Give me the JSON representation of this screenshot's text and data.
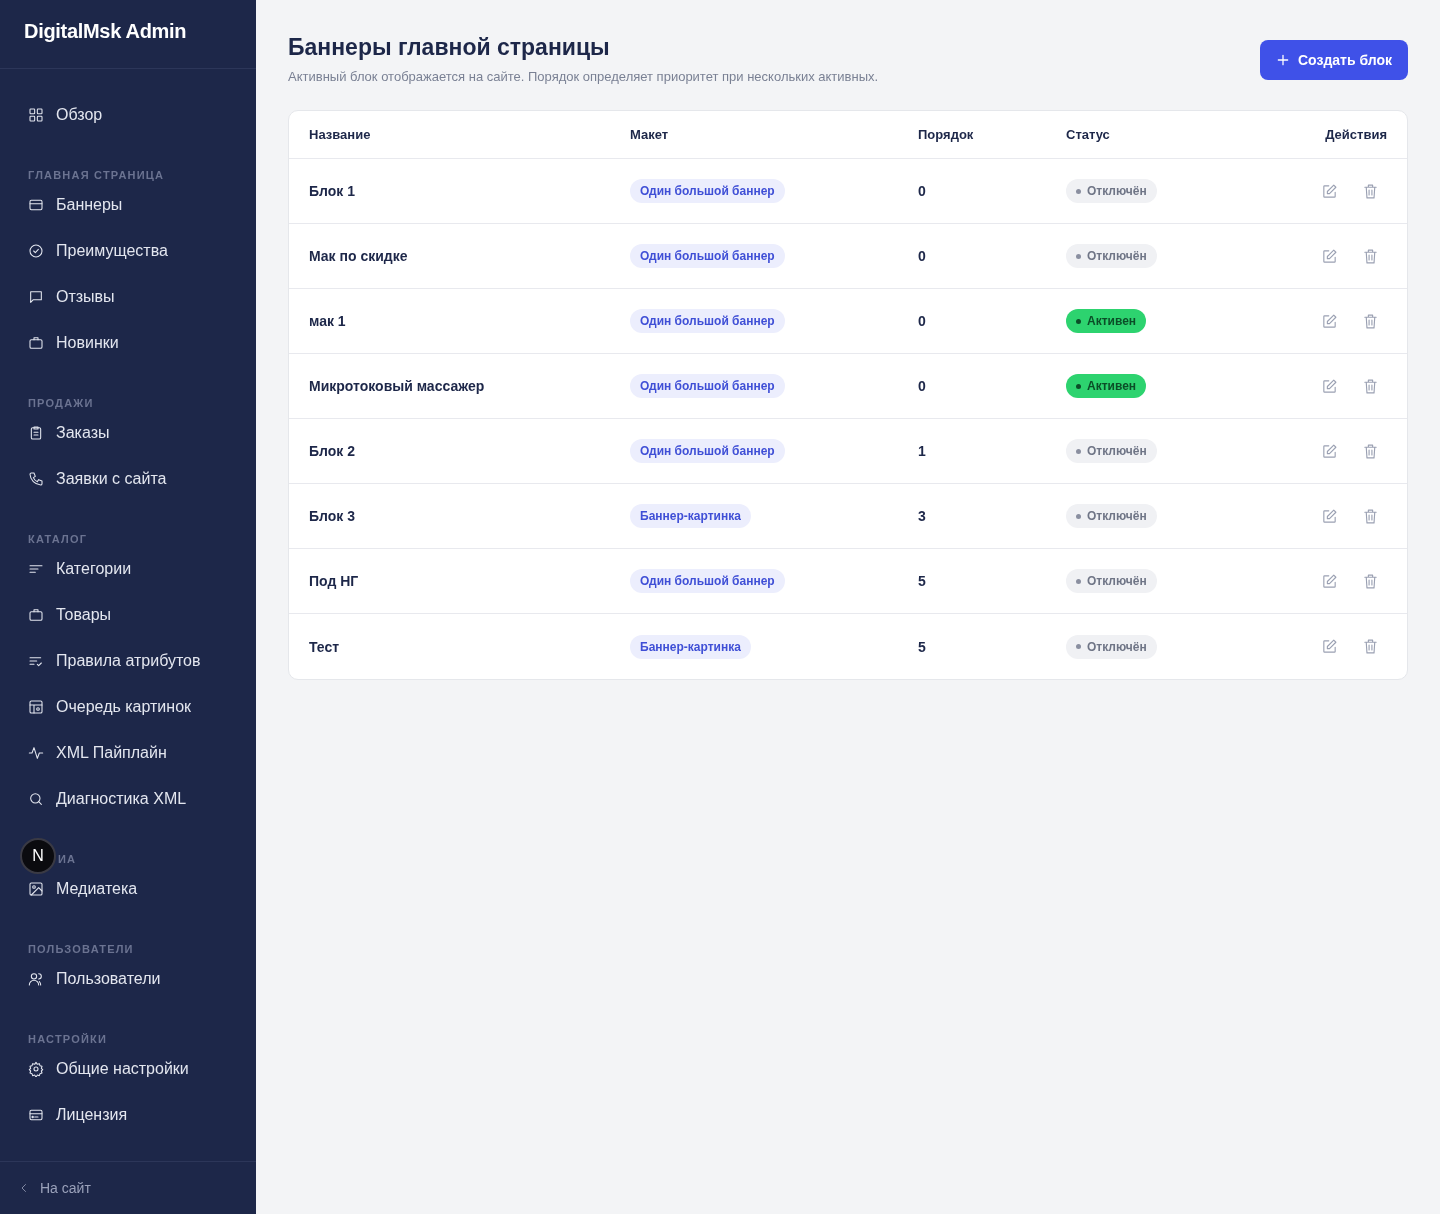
{
  "sidebar": {
    "logo": "DigitalMsk Admin",
    "sections": [
      {
        "items": [
          {
            "label": "Обзор"
          }
        ]
      },
      {
        "heading": "ГЛАВНАЯ СТРАНИЦА",
        "items": [
          {
            "label": "Баннеры"
          },
          {
            "label": "Преимущества"
          },
          {
            "label": "Отзывы"
          },
          {
            "label": "Новинки"
          }
        ]
      },
      {
        "heading": "ПРОДАЖИ",
        "items": [
          {
            "label": "Заказы"
          },
          {
            "label": "Заявки с сайта"
          }
        ]
      },
      {
        "heading": "КАТАЛОГ",
        "items": [
          {
            "label": "Категории"
          },
          {
            "label": "Товары"
          },
          {
            "label": "Правила атрибутов"
          },
          {
            "label": "Очередь картинок"
          },
          {
            "label": "XML Пайплайн"
          },
          {
            "label": "Диагностика XML"
          }
        ]
      },
      {
        "heading": "ИА",
        "badge": "N",
        "items": [
          {
            "label": "Медиатека"
          }
        ]
      },
      {
        "heading": "ПОЛЬЗОВАТЕЛИ",
        "items": [
          {
            "label": "Пользователи"
          }
        ]
      },
      {
        "heading": "НАСТРОЙКИ",
        "items": [
          {
            "label": "Общие настройки"
          },
          {
            "label": "Лицензия"
          }
        ]
      }
    ],
    "back_link": "На сайт"
  },
  "page": {
    "title": "Баннеры главной страницы",
    "subtitle": "Активный блок отображается на сайте. Порядок определяет приоритет при нескольких активных.",
    "create_button": "Создать блок"
  },
  "table": {
    "columns": [
      "Название",
      "Макет",
      "Порядок",
      "Статус",
      "Действия"
    ],
    "rows": [
      {
        "name": "Блок 1",
        "layout": "Один большой баннер",
        "order": "0",
        "status": "Отключён",
        "active": false
      },
      {
        "name": "Мак по скидке",
        "layout": "Один большой баннер",
        "order": "0",
        "status": "Отключён",
        "active": false
      },
      {
        "name": "мак 1",
        "layout": "Один большой баннер",
        "order": "0",
        "status": "Активен",
        "active": true
      },
      {
        "name": "Микротоковый массажер",
        "layout": "Один большой баннер",
        "order": "0",
        "status": "Активен",
        "active": true
      },
      {
        "name": "Блок 2",
        "layout": "Один большой баннер",
        "order": "1",
        "status": "Отключён",
        "active": false
      },
      {
        "name": "Блок 3",
        "layout": "Баннер-картинка",
        "order": "3",
        "status": "Отключён",
        "active": false
      },
      {
        "name": "Под НГ",
        "layout": "Один большой баннер",
        "order": "5",
        "status": "Отключён",
        "active": false
      },
      {
        "name": "Тест",
        "layout": "Баннер-картинка",
        "order": "5",
        "status": "Отключён",
        "active": false
      }
    ]
  }
}
